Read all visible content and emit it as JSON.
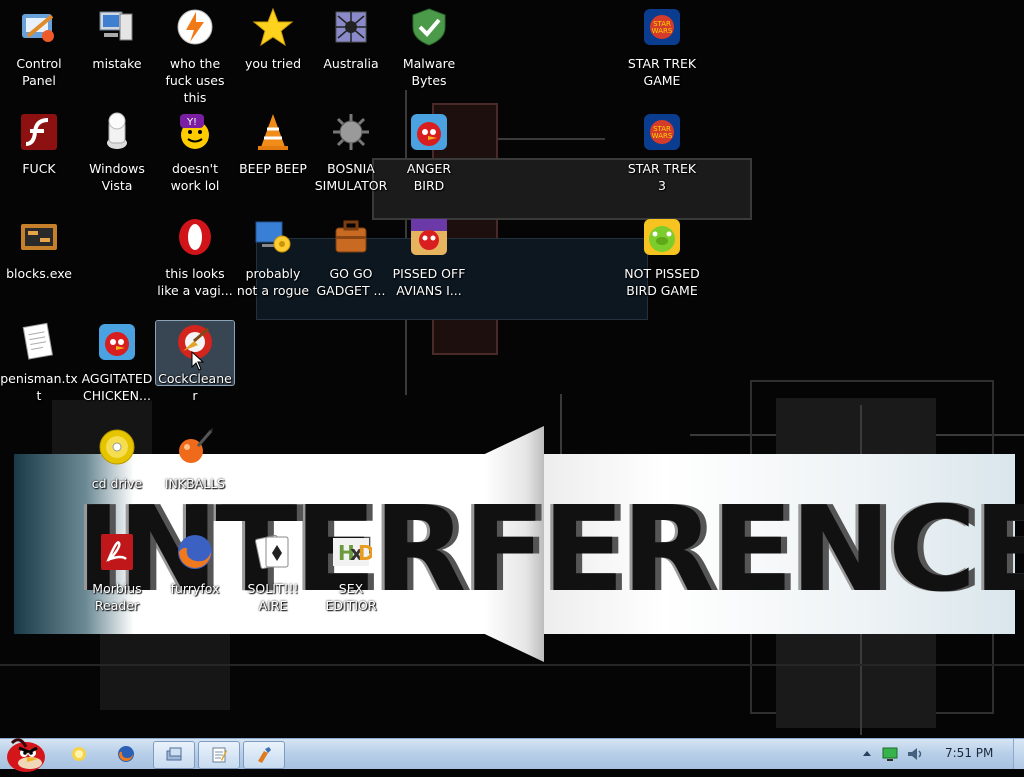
{
  "desktop": {
    "banner_text": "INTERFERENCE",
    "icons": [
      {
        "label": "Control Panel",
        "icon": "control-panel-icon"
      },
      {
        "label": "mistake",
        "icon": "computer-icon"
      },
      {
        "label": "who the fuck uses this",
        "icon": "winamp-icon"
      },
      {
        "label": "you tried",
        "icon": "star-icon"
      },
      {
        "label": "Australia",
        "icon": "spider-icon"
      },
      {
        "label": "Malware Bytes",
        "icon": "shield-icon"
      },
      {
        "label": "STAR TREK GAME",
        "icon": "star-wars-game-icon"
      },
      {
        "label": "FUCK",
        "icon": "flash-icon"
      },
      {
        "label": "Windows Vista",
        "icon": "windows-vista-icon"
      },
      {
        "label": "doesn't work lol",
        "icon": "yahoo-messenger-icon"
      },
      {
        "label": "BEEP BEEP",
        "icon": "vlc-cone-icon"
      },
      {
        "label": "BOSNIA SIMULATOR",
        "icon": "spiked-mine-icon"
      },
      {
        "label": "ANGER BIRD",
        "icon": "angry-bird-icon"
      },
      {
        "label": "STAR TREK 3",
        "icon": "star-wars-game-icon"
      },
      {
        "label": "blocks.exe",
        "icon": "blocks-game-icon"
      },
      {
        "label": "this looks like a vagi...",
        "icon": "opera-icon"
      },
      {
        "label": "probably not a rogue",
        "icon": "gear-computer-icon"
      },
      {
        "label": "GO GO GADGET ...",
        "icon": "briefcase-icon"
      },
      {
        "label": "PISSED OFF AVIANS I...",
        "icon": "angry-birds-seasons-icon"
      },
      {
        "label": "NOT PISSED BIRD GAME",
        "icon": "green-pig-icon"
      },
      {
        "label": "penisman.txt",
        "icon": "text-document-icon"
      },
      {
        "label": "AGGITATED CHICKEN...",
        "icon": "angry-bird-icon"
      },
      {
        "label": "CockCleaner",
        "icon": "ccleaner-icon"
      },
      {
        "label": "cd drive",
        "icon": "cd-drive-icon"
      },
      {
        "label": "INKBALLS",
        "icon": "inkball-icon"
      },
      {
        "label": "Morbius Reader",
        "icon": "pdf-reader-icon"
      },
      {
        "label": "furryfox",
        "icon": "firefox-icon"
      },
      {
        "label": "SOLIT!!! AIRE",
        "icon": "solitaire-icon"
      },
      {
        "label": "SEX EDITIOR",
        "icon": "hex-editor-icon"
      }
    ]
  },
  "taskbar": {
    "start_icon": "angry-bird-start-icon",
    "pinned": [
      "explorer-icon",
      "firefox-icon",
      "window-switch-icon",
      "notepad-icon",
      "paint-icon"
    ],
    "tray_icons": [
      "show-hidden-icon",
      "network-icon",
      "volume-icon"
    ],
    "clock": "7:51 PM"
  },
  "colors": {
    "taskbar_top": "#d6e4f3",
    "taskbar_bottom": "#a6c1e0",
    "desktop_bg": "#050505",
    "selection": "#8aa3b8"
  }
}
